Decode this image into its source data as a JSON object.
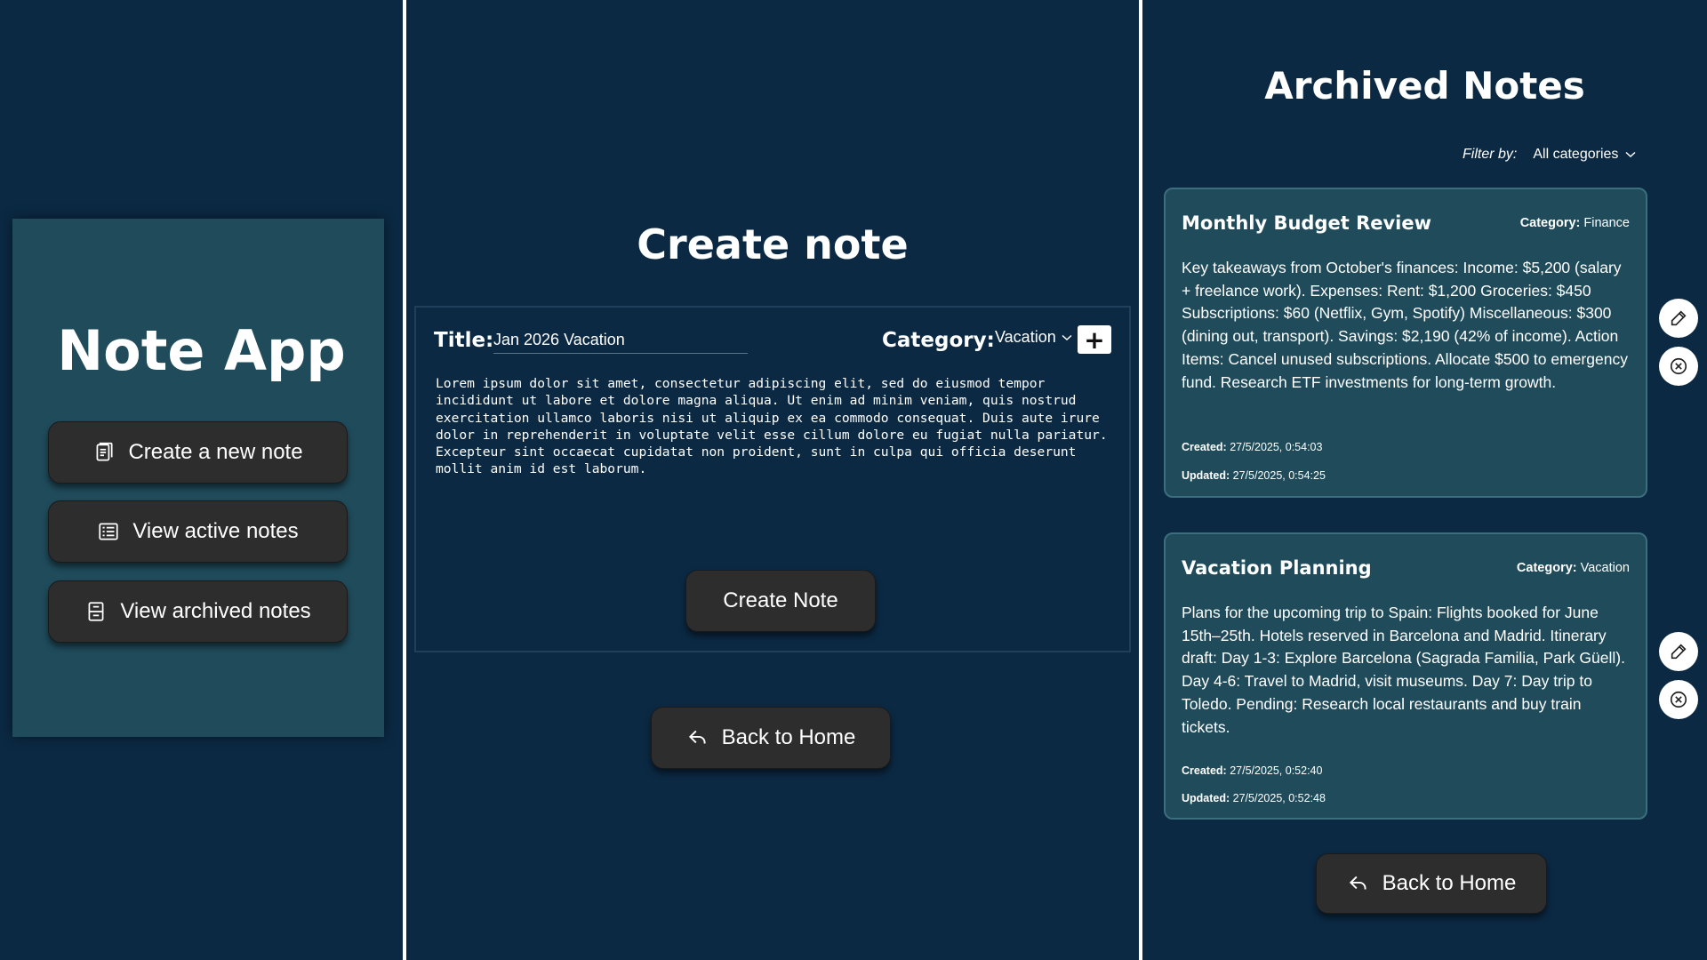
{
  "colors": {
    "background": "#0b2943",
    "card": "#1f4b5b",
    "button": "#2d2d2d",
    "divider": "#ffffff"
  },
  "home": {
    "title": "Note App",
    "buttons": [
      {
        "label": "Create a new note",
        "icon": "note-icon"
      },
      {
        "label": "View active notes",
        "icon": "list-icon"
      },
      {
        "label": "View archived notes",
        "icon": "archive-icon"
      }
    ]
  },
  "create": {
    "heading": "Create note",
    "title_label": "Title:",
    "title_value": "Jan 2026 Vacation",
    "category_label": "Category:",
    "category_value": "Vacation",
    "add_category_label": "+",
    "body": "Lorem ipsum dolor sit amet, consectetur adipiscing elit, sed do eiusmod tempor incididunt ut labore et dolore magna aliqua. Ut enim ad minim veniam, quis nostrud exercitation ullamco laboris nisi ut aliquip ex ea commodo consequat. Duis aute irure dolor in reprehenderit in voluptate velit esse cillum dolore eu fugiat nulla pariatur. Excepteur sint occaecat cupidatat non proident, sunt in culpa qui officia deserunt mollit anim id est laborum.",
    "submit_label": "Create Note",
    "back_label": "Back to Home"
  },
  "archive": {
    "heading": "Archived Notes",
    "filter_label": "Filter by:",
    "filter_value": "All categories",
    "notes": [
      {
        "title": "Monthly Budget Review",
        "category_label": "Category:",
        "category": "Finance",
        "body": "Key takeaways from October's finances: Income: $5,200 (salary + freelance work). Expenses: Rent: $1,200 Groceries: $450 Subscriptions: $60 (Netflix, Gym, Spotify) Miscellaneous: $300 (dining out, transport). Savings: $2,190 (42% of income). Action Items: Cancel unused subscriptions. Allocate $500 to emergency fund. Research ETF investments for long-term growth.",
        "created_label": "Created:",
        "created": "27/5/2025, 0:54:03",
        "updated_label": "Updated:",
        "updated": "27/5/2025, 0:54:25"
      },
      {
        "title": "Vacation Planning",
        "category_label": "Category:",
        "category": "Vacation",
        "body": "Plans for the upcoming trip to Spain: Flights booked for June 15th–25th. Hotels reserved in Barcelona and Madrid. Itinerary draft: Day 1-3: Explore Barcelona (Sagrada Familia, Park Güell). Day 4-6: Travel to Madrid, visit museums. Day 7: Day trip to Toledo. Pending: Research local restaurants and buy train tickets.",
        "created_label": "Created:",
        "created": "27/5/2025, 0:52:40",
        "updated_label": "Updated:",
        "updated": "27/5/2025, 0:52:48"
      }
    ],
    "back_label": "Back to Home"
  }
}
